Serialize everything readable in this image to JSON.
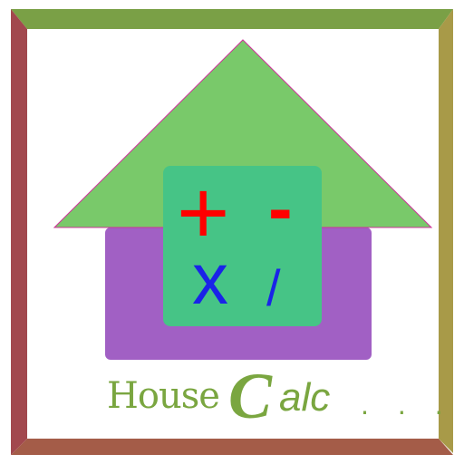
{
  "title": {
    "house": "House",
    "calc_initial": "C",
    "calc_rest": "alc",
    "dots": "...",
    "color": "#7aa640"
  },
  "operators": {
    "plus": "+",
    "minus": "-",
    "times": "x",
    "divide": "/",
    "plus_minus_color": "#ff0000",
    "times_divide_color": "#1a23e8"
  },
  "colors": {
    "frame_top": "#7aa046",
    "frame_right": "#a89a48",
    "frame_bottom": "#a45c48",
    "frame_left": "#a2484e",
    "roof": "#79c96a",
    "body": "#a160c4",
    "calculator": "#46c486"
  }
}
